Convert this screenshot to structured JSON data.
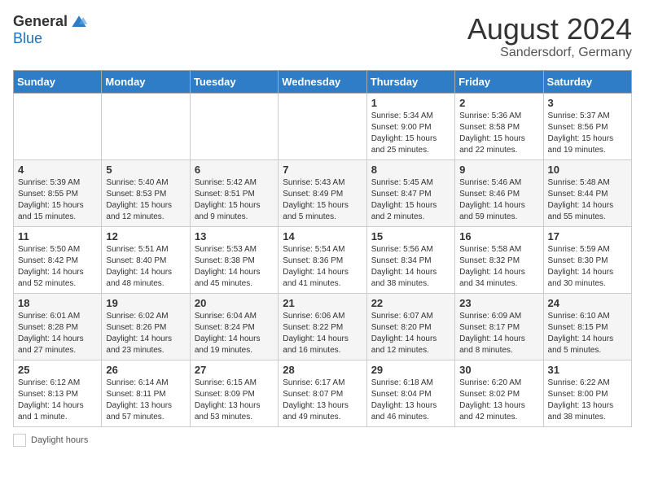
{
  "header": {
    "logo_general": "General",
    "logo_blue": "Blue",
    "month_title": "August 2024",
    "location": "Sandersdorf, Germany"
  },
  "calendar": {
    "days_of_week": [
      "Sunday",
      "Monday",
      "Tuesday",
      "Wednesday",
      "Thursday",
      "Friday",
      "Saturday"
    ],
    "weeks": [
      [
        {
          "day": "",
          "info": ""
        },
        {
          "day": "",
          "info": ""
        },
        {
          "day": "",
          "info": ""
        },
        {
          "day": "",
          "info": ""
        },
        {
          "day": "1",
          "info": "Sunrise: 5:34 AM\nSunset: 9:00 PM\nDaylight: 15 hours\nand 25 minutes."
        },
        {
          "day": "2",
          "info": "Sunrise: 5:36 AM\nSunset: 8:58 PM\nDaylight: 15 hours\nand 22 minutes."
        },
        {
          "day": "3",
          "info": "Sunrise: 5:37 AM\nSunset: 8:56 PM\nDaylight: 15 hours\nand 19 minutes."
        }
      ],
      [
        {
          "day": "4",
          "info": "Sunrise: 5:39 AM\nSunset: 8:55 PM\nDaylight: 15 hours\nand 15 minutes."
        },
        {
          "day": "5",
          "info": "Sunrise: 5:40 AM\nSunset: 8:53 PM\nDaylight: 15 hours\nand 12 minutes."
        },
        {
          "day": "6",
          "info": "Sunrise: 5:42 AM\nSunset: 8:51 PM\nDaylight: 15 hours\nand 9 minutes."
        },
        {
          "day": "7",
          "info": "Sunrise: 5:43 AM\nSunset: 8:49 PM\nDaylight: 15 hours\nand 5 minutes."
        },
        {
          "day": "8",
          "info": "Sunrise: 5:45 AM\nSunset: 8:47 PM\nDaylight: 15 hours\nand 2 minutes."
        },
        {
          "day": "9",
          "info": "Sunrise: 5:46 AM\nSunset: 8:46 PM\nDaylight: 14 hours\nand 59 minutes."
        },
        {
          "day": "10",
          "info": "Sunrise: 5:48 AM\nSunset: 8:44 PM\nDaylight: 14 hours\nand 55 minutes."
        }
      ],
      [
        {
          "day": "11",
          "info": "Sunrise: 5:50 AM\nSunset: 8:42 PM\nDaylight: 14 hours\nand 52 minutes."
        },
        {
          "day": "12",
          "info": "Sunrise: 5:51 AM\nSunset: 8:40 PM\nDaylight: 14 hours\nand 48 minutes."
        },
        {
          "day": "13",
          "info": "Sunrise: 5:53 AM\nSunset: 8:38 PM\nDaylight: 14 hours\nand 45 minutes."
        },
        {
          "day": "14",
          "info": "Sunrise: 5:54 AM\nSunset: 8:36 PM\nDaylight: 14 hours\nand 41 minutes."
        },
        {
          "day": "15",
          "info": "Sunrise: 5:56 AM\nSunset: 8:34 PM\nDaylight: 14 hours\nand 38 minutes."
        },
        {
          "day": "16",
          "info": "Sunrise: 5:58 AM\nSunset: 8:32 PM\nDaylight: 14 hours\nand 34 minutes."
        },
        {
          "day": "17",
          "info": "Sunrise: 5:59 AM\nSunset: 8:30 PM\nDaylight: 14 hours\nand 30 minutes."
        }
      ],
      [
        {
          "day": "18",
          "info": "Sunrise: 6:01 AM\nSunset: 8:28 PM\nDaylight: 14 hours\nand 27 minutes."
        },
        {
          "day": "19",
          "info": "Sunrise: 6:02 AM\nSunset: 8:26 PM\nDaylight: 14 hours\nand 23 minutes."
        },
        {
          "day": "20",
          "info": "Sunrise: 6:04 AM\nSunset: 8:24 PM\nDaylight: 14 hours\nand 19 minutes."
        },
        {
          "day": "21",
          "info": "Sunrise: 6:06 AM\nSunset: 8:22 PM\nDaylight: 14 hours\nand 16 minutes."
        },
        {
          "day": "22",
          "info": "Sunrise: 6:07 AM\nSunset: 8:20 PM\nDaylight: 14 hours\nand 12 minutes."
        },
        {
          "day": "23",
          "info": "Sunrise: 6:09 AM\nSunset: 8:17 PM\nDaylight: 14 hours\nand 8 minutes."
        },
        {
          "day": "24",
          "info": "Sunrise: 6:10 AM\nSunset: 8:15 PM\nDaylight: 14 hours\nand 5 minutes."
        }
      ],
      [
        {
          "day": "25",
          "info": "Sunrise: 6:12 AM\nSunset: 8:13 PM\nDaylight: 14 hours\nand 1 minute."
        },
        {
          "day": "26",
          "info": "Sunrise: 6:14 AM\nSunset: 8:11 PM\nDaylight: 13 hours\nand 57 minutes."
        },
        {
          "day": "27",
          "info": "Sunrise: 6:15 AM\nSunset: 8:09 PM\nDaylight: 13 hours\nand 53 minutes."
        },
        {
          "day": "28",
          "info": "Sunrise: 6:17 AM\nSunset: 8:07 PM\nDaylight: 13 hours\nand 49 minutes."
        },
        {
          "day": "29",
          "info": "Sunrise: 6:18 AM\nSunset: 8:04 PM\nDaylight: 13 hours\nand 46 minutes."
        },
        {
          "day": "30",
          "info": "Sunrise: 6:20 AM\nSunset: 8:02 PM\nDaylight: 13 hours\nand 42 minutes."
        },
        {
          "day": "31",
          "info": "Sunrise: 6:22 AM\nSunset: 8:00 PM\nDaylight: 13 hours\nand 38 minutes."
        }
      ]
    ]
  },
  "footer": {
    "label": "Daylight hours"
  }
}
